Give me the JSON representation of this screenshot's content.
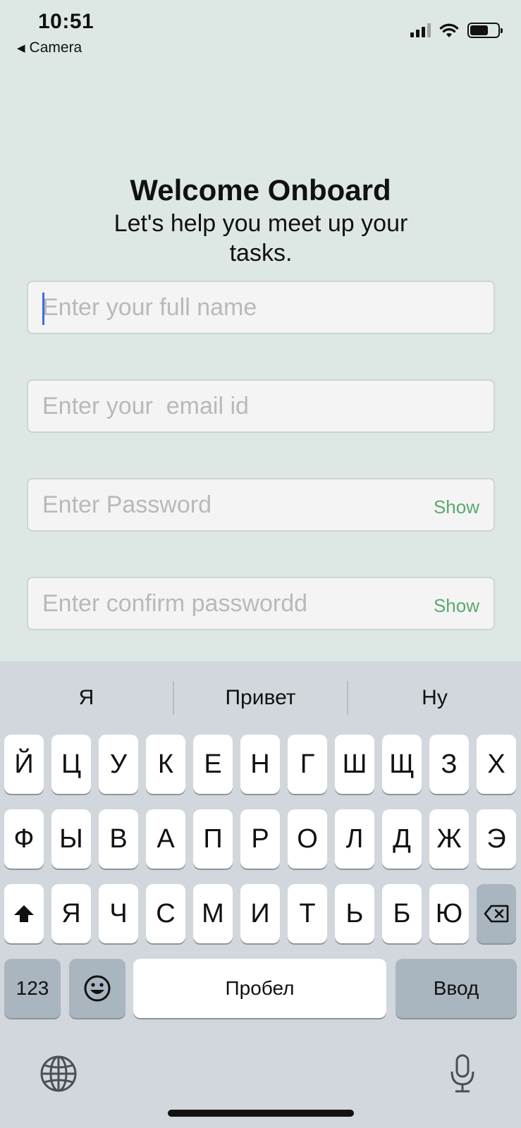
{
  "status_bar": {
    "time": "10:51",
    "back_label": "Camera"
  },
  "header": {
    "title": "Welcome Onboard",
    "subtitle": "Let's help you meet up your tasks."
  },
  "form": {
    "full_name": {
      "placeholder": "Enter your full name",
      "value": ""
    },
    "email": {
      "placeholder": "Enter your  email id",
      "value": ""
    },
    "password": {
      "placeholder": "Enter Password",
      "value": "",
      "toggle_label": "Show"
    },
    "confirm_password": {
      "placeholder": "Enter confirm passwordd",
      "value": "",
      "toggle_label": "Show"
    }
  },
  "keyboard": {
    "suggestions": [
      "Я",
      "Привет",
      "Ну"
    ],
    "row1": [
      "Й",
      "Ц",
      "У",
      "К",
      "Е",
      "Н",
      "Г",
      "Ш",
      "Щ",
      "З",
      "Х"
    ],
    "row2": [
      "Ф",
      "Ы",
      "В",
      "А",
      "П",
      "Р",
      "О",
      "Л",
      "Д",
      "Ж",
      "Э"
    ],
    "row3": [
      "Я",
      "Ч",
      "С",
      "М",
      "И",
      "Т",
      "Ь",
      "Б",
      "Ю"
    ],
    "numbers_label": "123",
    "space_label": "Пробел",
    "return_label": "Ввод"
  },
  "colors": {
    "background": "#dde8e5",
    "accent_show": "#5ba86e",
    "caret": "#3b6de0"
  },
  "icons": [
    "back-arrow-icon",
    "signal-icon",
    "wifi-icon",
    "battery-icon",
    "shift-icon",
    "backspace-icon",
    "emoji-icon",
    "globe-icon",
    "microphone-icon"
  ]
}
